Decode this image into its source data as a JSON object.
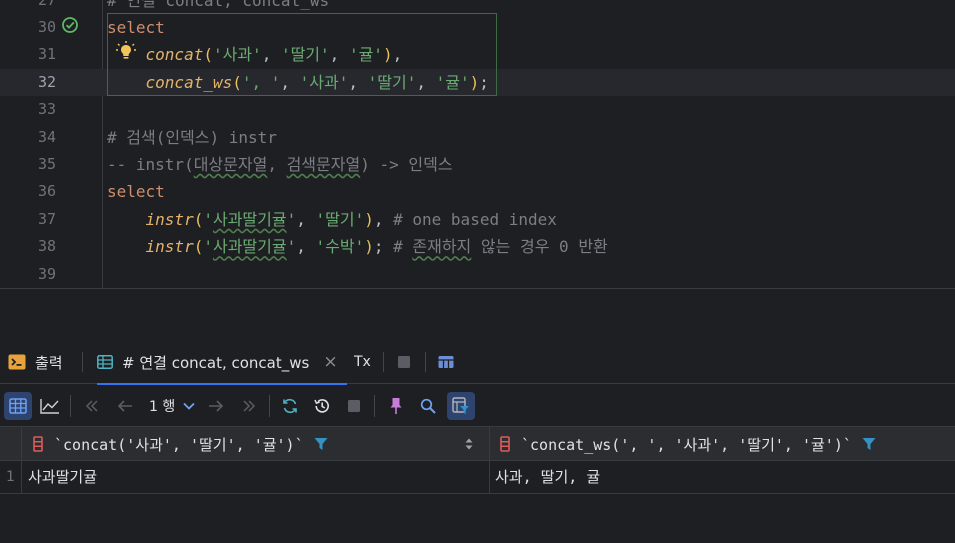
{
  "editor": {
    "lines": [
      {
        "num": "27",
        "tokens": [
          {
            "t": "# 연결 concat, concat_ws",
            "c": "cm"
          }
        ]
      },
      {
        "num": "30",
        "tokens": [
          {
            "t": "select",
            "c": "kw"
          }
        ]
      },
      {
        "num": "31",
        "tokens": [
          {
            "t": "    ",
            "c": "pn"
          },
          {
            "t": "concat",
            "c": "fn"
          },
          {
            "t": "(",
            "c": "yp"
          },
          {
            "t": "'사과'",
            "c": "str"
          },
          {
            "t": ", ",
            "c": "pn"
          },
          {
            "t": "'딸기'",
            "c": "str"
          },
          {
            "t": ", ",
            "c": "pn"
          },
          {
            "t": "'귤'",
            "c": "str"
          },
          {
            "t": ")",
            "c": "yp"
          },
          {
            "t": ",",
            "c": "pn"
          }
        ]
      },
      {
        "num": "32",
        "tokens": [
          {
            "t": "    ",
            "c": "pn"
          },
          {
            "t": "concat_ws",
            "c": "fn"
          },
          {
            "t": "(",
            "c": "yp"
          },
          {
            "t": "', '",
            "c": "str"
          },
          {
            "t": ", ",
            "c": "pn"
          },
          {
            "t": "'사과'",
            "c": "str"
          },
          {
            "t": ", ",
            "c": "pn"
          },
          {
            "t": "'딸기'",
            "c": "str"
          },
          {
            "t": ", ",
            "c": "pn"
          },
          {
            "t": "'귤'",
            "c": "str"
          },
          {
            "t": ")",
            "c": "yp"
          },
          {
            "t": ";",
            "c": "pn"
          }
        ]
      },
      {
        "num": "33",
        "tokens": []
      },
      {
        "num": "34",
        "tokens": [
          {
            "t": "# 검색(인덱스) instr",
            "c": "cm"
          }
        ]
      },
      {
        "num": "35",
        "tokens": [
          {
            "t": "-- instr(",
            "c": "cm"
          },
          {
            "t": "대상문자열",
            "c": "cm",
            "w": true
          },
          {
            "t": ", ",
            "c": "cm"
          },
          {
            "t": "검색문자열",
            "c": "cm",
            "w": true
          },
          {
            "t": ") -> 인덱스",
            "c": "cm"
          }
        ]
      },
      {
        "num": "36",
        "tokens": [
          {
            "t": "select",
            "c": "kw"
          }
        ]
      },
      {
        "num": "37",
        "tokens": [
          {
            "t": "    ",
            "c": "pn"
          },
          {
            "t": "instr",
            "c": "fn"
          },
          {
            "t": "(",
            "c": "yp"
          },
          {
            "t": "'",
            "c": "str"
          },
          {
            "t": "사과딸기귤",
            "c": "str",
            "w": true
          },
          {
            "t": "'",
            "c": "str"
          },
          {
            "t": ", ",
            "c": "pn"
          },
          {
            "t": "'딸기'",
            "c": "str"
          },
          {
            "t": ")",
            "c": "yp"
          },
          {
            "t": ", ",
            "c": "pn"
          },
          {
            "t": "# one based index",
            "c": "cm"
          }
        ]
      },
      {
        "num": "38",
        "tokens": [
          {
            "t": "    ",
            "c": "pn"
          },
          {
            "t": "instr",
            "c": "fn"
          },
          {
            "t": "(",
            "c": "yp"
          },
          {
            "t": "'",
            "c": "str"
          },
          {
            "t": "사과딸기귤",
            "c": "str",
            "w": true
          },
          {
            "t": "'",
            "c": "str"
          },
          {
            "t": ", ",
            "c": "pn"
          },
          {
            "t": "'수박'",
            "c": "str"
          },
          {
            "t": ")",
            "c": "yp"
          },
          {
            "t": "; ",
            "c": "pn"
          },
          {
            "t": "# ",
            "c": "cm"
          },
          {
            "t": "존재하지",
            "c": "cm",
            "w": true
          },
          {
            "t": " 않는 경우 0 반환",
            "c": "cm"
          }
        ]
      },
      {
        "num": "39",
        "tokens": []
      }
    ]
  },
  "tabs": {
    "output_label": "출력",
    "result_label": "# 연결 concat, concat_ws",
    "close": "×",
    "tx_label": "Tx"
  },
  "toolbar": {
    "row_count": "1 행"
  },
  "grid": {
    "columns": [
      {
        "label": "`concat('사과', '딸기', '귤')`"
      },
      {
        "label": "`concat_ws(', ', '사과', '딸기', '귤')`"
      }
    ],
    "rows": [
      {
        "num": "1",
        "cells": [
          "사과딸기귤",
          "사과, 딸기, 귤"
        ]
      }
    ]
  },
  "colors": {
    "accent": "#3574f0",
    "keyword": "#cf8e6d",
    "function": "#e4b36b",
    "string": "#6aab73",
    "comment": "#7a7e85",
    "run_ok": "#5fb865",
    "bulb": "#f2c55c",
    "filter": "#3592c4",
    "column_icon": "#db5c5c"
  }
}
